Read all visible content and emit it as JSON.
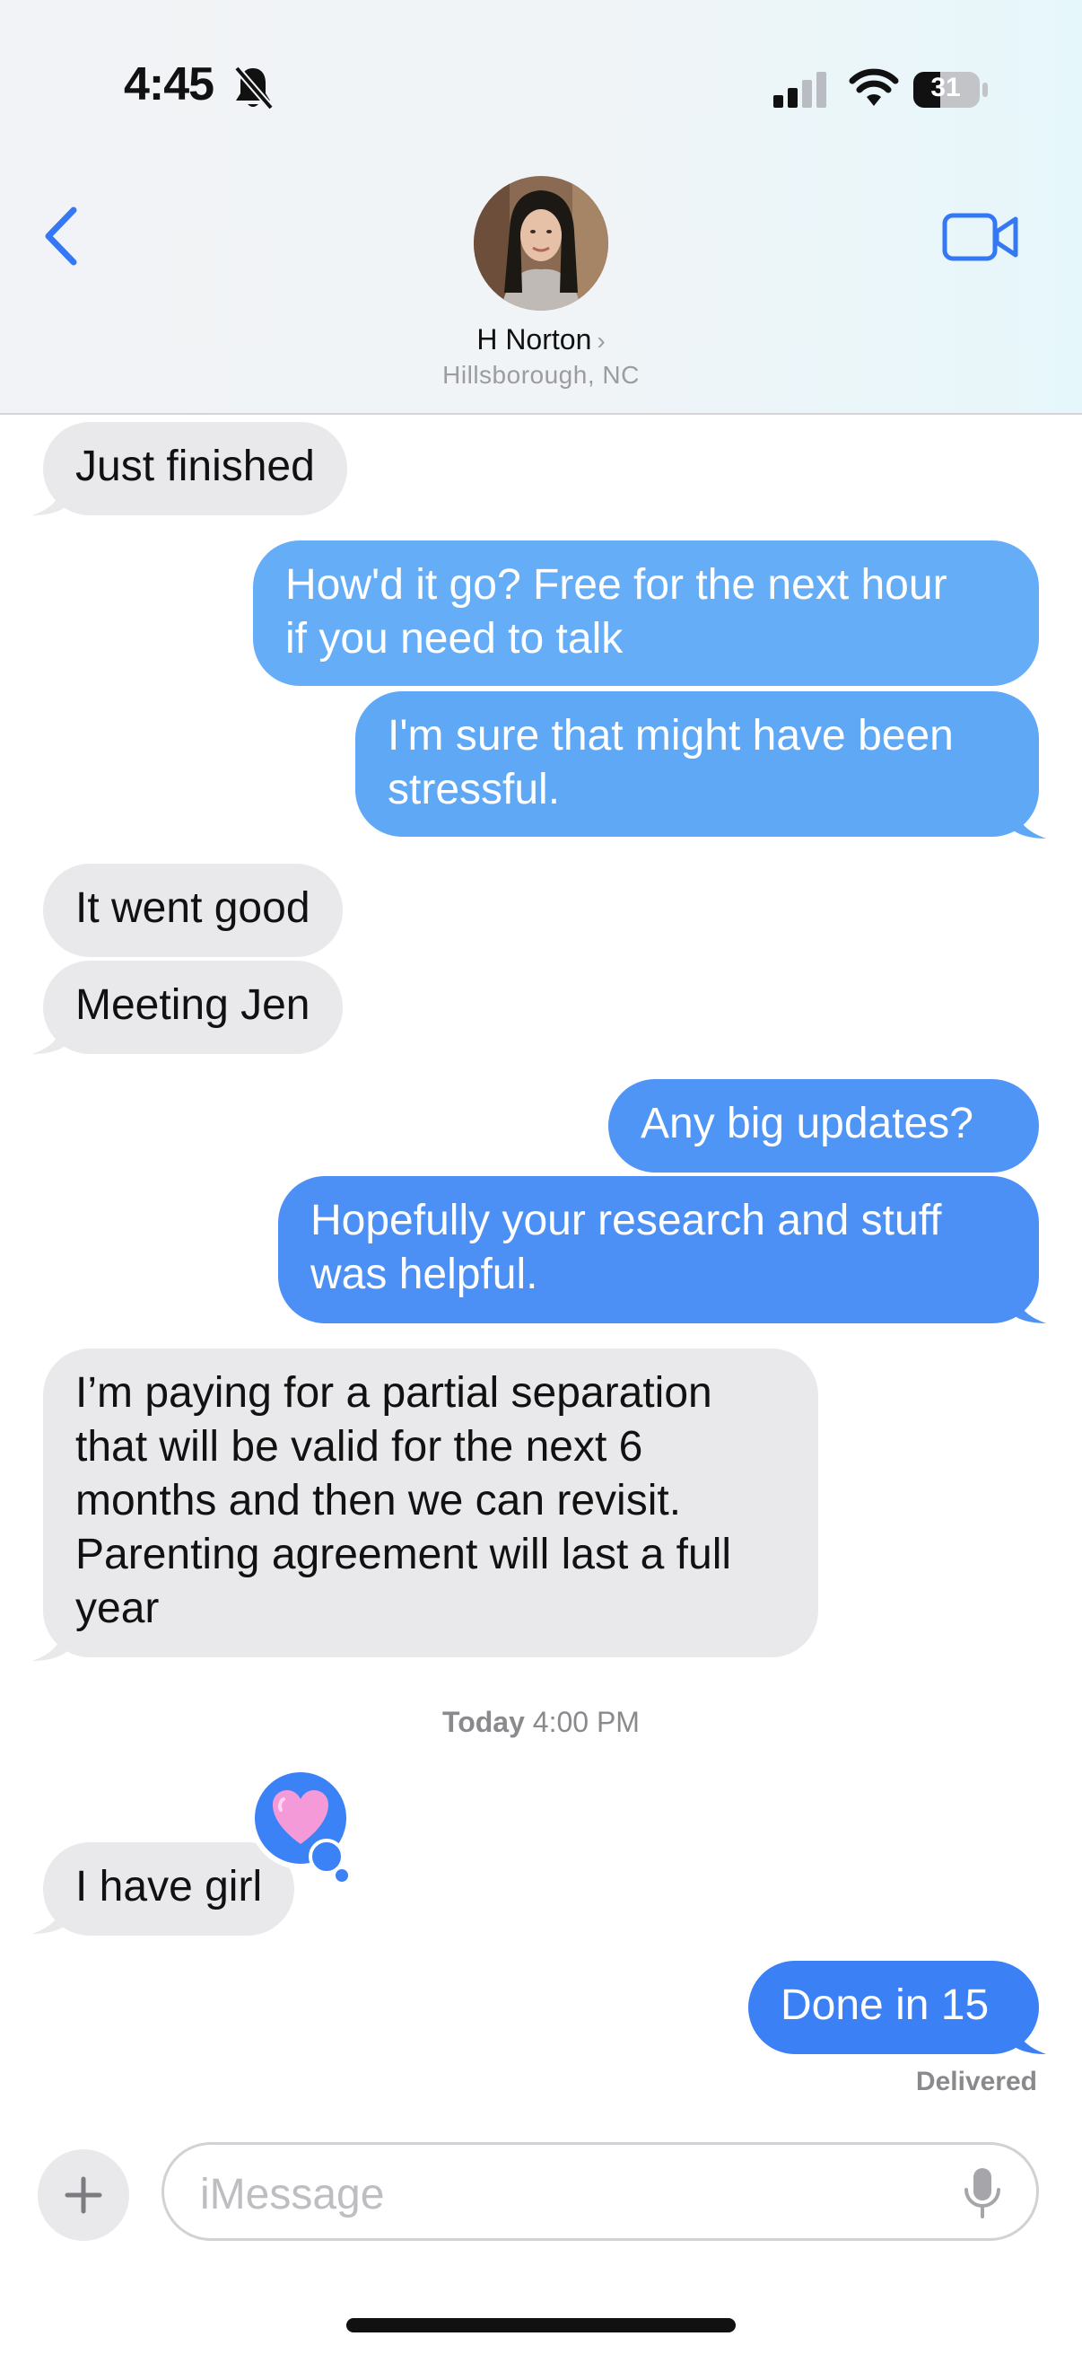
{
  "status_bar": {
    "time": "4:45",
    "battery": "31"
  },
  "header": {
    "contact_name": "H Norton",
    "location": "Hillsborough, NC"
  },
  "messages": [
    {
      "text": "Just finished"
    },
    {
      "text": "How'd it go? Free for the next hour\nif you need to talk"
    },
    {
      "text": "I'm sure that might have been\nstressful."
    },
    {
      "text": "It went good"
    },
    {
      "text": "Meeting Jen"
    },
    {
      "text": "Any big updates?"
    },
    {
      "text": "Hopefully your research and stuff\nwas helpful."
    },
    {
      "text": "I’m paying for a partial separation\nthat will be valid for the next 6\nmonths and then we can revisit.\nParenting agreement will last a full\nyear"
    },
    {
      "text": "I have girl"
    },
    {
      "text": "Done in 15"
    }
  ],
  "timestamp": {
    "day": "Today",
    "time": "4:00 PM"
  },
  "reaction": {
    "icon": "pink-heart-icon"
  },
  "status": {
    "delivered": "Delivered"
  },
  "compose": {
    "placeholder": "iMessage"
  },
  "colors": {
    "incoming_bubble": "#e9e9eb",
    "outgoing_light": "#64acf7",
    "outgoing_dark": "#3b80f4",
    "accent": "#3478f6"
  }
}
